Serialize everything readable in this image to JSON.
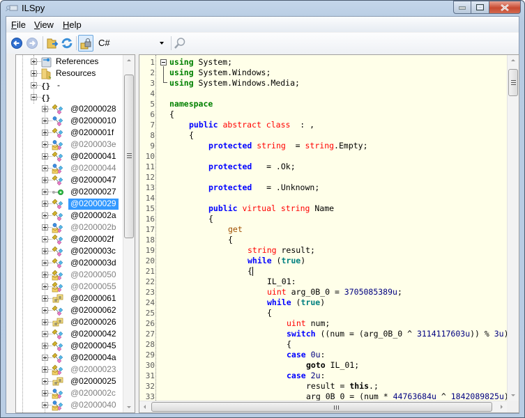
{
  "window": {
    "title": "ILSpy",
    "caption_buttons": [
      "minimize",
      "maximize",
      "close"
    ]
  },
  "menu": {
    "items": [
      {
        "label": "File",
        "accesskey": "F",
        "rest": "ile"
      },
      {
        "label": "View",
        "accesskey": "V",
        "rest": "iew"
      },
      {
        "label": "Help",
        "accesskey": "H",
        "rest": "elp"
      }
    ]
  },
  "toolbar": {
    "buttons": [
      {
        "name": "back",
        "icon": "back-arrow-icon"
      },
      {
        "name": "forward",
        "icon": "forward-arrow-icon"
      },
      {
        "name": "open",
        "icon": "open-folder-icon"
      },
      {
        "name": "reload",
        "icon": "refresh-icon"
      },
      {
        "name": "show-internal",
        "icon": "lock-icon",
        "pressed": true
      }
    ],
    "language": "C#",
    "search_icon": "search-icon"
  },
  "tree": {
    "nodes": [
      {
        "label": "References",
        "icon": "references-icon",
        "expander": "plus",
        "level": 1,
        "style": "normal"
      },
      {
        "label": "Resources",
        "icon": "folder-icon",
        "expander": "plus",
        "level": 1,
        "style": "normal"
      },
      {
        "label": "-",
        "icon": "namespace-icon",
        "expander": "plus",
        "level": 1,
        "style": "normal"
      },
      {
        "label": "",
        "icon": "namespace-icon",
        "expander": "minus",
        "level": 1,
        "style": "normal"
      },
      {
        "label": "@02000028",
        "icon": "class-icon",
        "expander": "plus",
        "level": 2,
        "style": "normal"
      },
      {
        "label": "@02000010",
        "icon": "class-blue-icon",
        "expander": "plus",
        "level": 2,
        "style": "normal"
      },
      {
        "label": "@0200001f",
        "icon": "class-icon",
        "expander": "plus",
        "level": 2,
        "style": "normal"
      },
      {
        "label": "@0200003e",
        "icon": "internal-class-icon",
        "expander": "plus",
        "level": 2,
        "style": "gray"
      },
      {
        "label": "@02000041",
        "icon": "class-icon",
        "expander": "plus",
        "level": 2,
        "style": "normal"
      },
      {
        "label": "@02000044",
        "icon": "internal-class-icon",
        "expander": "plus",
        "level": 2,
        "style": "gray"
      },
      {
        "label": "@02000047",
        "icon": "class-icon",
        "expander": "plus",
        "level": 2,
        "style": "normal"
      },
      {
        "label": "@02000027",
        "icon": "interface-icon",
        "expander": "plus",
        "level": 2,
        "style": "normal"
      },
      {
        "label": "@02000029",
        "icon": "class-icon",
        "expander": "plus",
        "level": 2,
        "style": "selected"
      },
      {
        "label": "@0200002a",
        "icon": "class-icon",
        "expander": "plus",
        "level": 2,
        "style": "normal"
      },
      {
        "label": "@0200002b",
        "icon": "internal-class-icon",
        "expander": "plus",
        "level": 2,
        "style": "gray"
      },
      {
        "label": "@0200002f",
        "icon": "class-icon",
        "expander": "plus",
        "level": 2,
        "style": "normal"
      },
      {
        "label": "@0200003c",
        "icon": "class-icon",
        "expander": "plus",
        "level": 2,
        "style": "normal"
      },
      {
        "label": "@0200003d",
        "icon": "class-icon",
        "expander": "plus",
        "level": 2,
        "style": "normal"
      },
      {
        "label": "@02000050",
        "icon": "internal-class-yellow-icon",
        "expander": "plus",
        "level": 2,
        "style": "gray"
      },
      {
        "label": "@02000055",
        "icon": "internal-class-yellow-icon",
        "expander": "plus",
        "level": 2,
        "style": "gray"
      },
      {
        "label": "@02000061",
        "icon": "enum-icon",
        "expander": "plus",
        "level": 2,
        "style": "normal"
      },
      {
        "label": "@02000062",
        "icon": "class-icon",
        "expander": "plus",
        "level": 2,
        "style": "normal"
      },
      {
        "label": "@02000026",
        "icon": "enum-icon",
        "expander": "plus",
        "level": 2,
        "style": "normal"
      },
      {
        "label": "@02000042",
        "icon": "class-icon",
        "expander": "plus",
        "level": 2,
        "style": "normal"
      },
      {
        "label": "@02000045",
        "icon": "class-icon",
        "expander": "plus",
        "level": 2,
        "style": "normal"
      },
      {
        "label": "@0200004a",
        "icon": "class-icon",
        "expander": "plus",
        "level": 2,
        "style": "normal"
      },
      {
        "label": "@02000023",
        "icon": "internal-class-yellow-icon",
        "expander": "plus",
        "level": 2,
        "style": "gray"
      },
      {
        "label": "@02000025",
        "icon": "enum-icon",
        "expander": "plus",
        "level": 2,
        "style": "normal"
      },
      {
        "label": "@0200002c",
        "icon": "internal-class-icon",
        "expander": "plus",
        "level": 2,
        "style": "gray"
      },
      {
        "label": "@02000040",
        "icon": "internal-class-icon",
        "expander": "plus",
        "level": 2,
        "style": "gray"
      }
    ]
  },
  "editor": {
    "lines": [
      {
        "n": "1",
        "indent": 0,
        "tokens": [
          [
            "using",
            "kw-green"
          ],
          [
            " System;",
            ""
          ]
        ]
      },
      {
        "n": "2",
        "indent": 0,
        "tokens": [
          [
            "using",
            "kw-green"
          ],
          [
            " System.Windows;",
            ""
          ]
        ]
      },
      {
        "n": "3",
        "indent": 0,
        "tokens": [
          [
            "using",
            "kw-green"
          ],
          [
            " System.Windows.Media;",
            ""
          ]
        ]
      },
      {
        "n": "4",
        "indent": 0,
        "tokens": []
      },
      {
        "n": "5",
        "indent": 0,
        "tokens": [
          [
            "namespace",
            "kw-green"
          ]
        ]
      },
      {
        "n": "6",
        "indent": 0,
        "tokens": [
          [
            "{",
            ""
          ]
        ]
      },
      {
        "n": "7",
        "indent": 1,
        "tokens": [
          [
            "public",
            "kw-blue"
          ],
          [
            " ",
            ""
          ],
          [
            "abstract class",
            "kw-red"
          ],
          [
            "  : ,",
            ""
          ]
        ]
      },
      {
        "n": "8",
        "indent": 1,
        "tokens": [
          [
            "{",
            ""
          ]
        ]
      },
      {
        "n": "9",
        "indent": 2,
        "tokens": [
          [
            "protected",
            "kw-blue"
          ],
          [
            " ",
            ""
          ],
          [
            "string",
            "kw-red"
          ],
          [
            "  = ",
            ""
          ],
          [
            "string",
            "kw-red"
          ],
          [
            ".Empty;",
            ""
          ]
        ]
      },
      {
        "n": "10",
        "indent": 0,
        "tokens": []
      },
      {
        "n": "11",
        "indent": 2,
        "tokens": [
          [
            "protected",
            "kw-blue"
          ],
          [
            "   = .Ok;",
            ""
          ]
        ]
      },
      {
        "n": "12",
        "indent": 0,
        "tokens": []
      },
      {
        "n": "13",
        "indent": 2,
        "tokens": [
          [
            "protected",
            "kw-blue"
          ],
          [
            "   = .Unknown;",
            ""
          ]
        ]
      },
      {
        "n": "14",
        "indent": 0,
        "tokens": []
      },
      {
        "n": "15",
        "indent": 2,
        "tokens": [
          [
            "public",
            "kw-blue"
          ],
          [
            " ",
            ""
          ],
          [
            "virtual string",
            "kw-red"
          ],
          [
            " Name",
            ""
          ]
        ]
      },
      {
        "n": "16",
        "indent": 2,
        "tokens": [
          [
            "{",
            ""
          ]
        ]
      },
      {
        "n": "17",
        "indent": 3,
        "tokens": [
          [
            "get",
            "kw-brown"
          ]
        ]
      },
      {
        "n": "18",
        "indent": 3,
        "tokens": [
          [
            "{",
            ""
          ]
        ]
      },
      {
        "n": "19",
        "indent": 4,
        "tokens": [
          [
            "string",
            "kw-red"
          ],
          [
            " result;",
            ""
          ]
        ]
      },
      {
        "n": "20",
        "indent": 4,
        "tokens": [
          [
            "while",
            "kw-blue"
          ],
          [
            " (",
            ""
          ],
          [
            "true",
            "kw-teal"
          ],
          [
            ")",
            ""
          ]
        ]
      },
      {
        "n": "21",
        "indent": 4,
        "tokens": [
          [
            "{",
            ""
          ]
        ],
        "cursor": true
      },
      {
        "n": "22",
        "indent": 5,
        "tokens": [
          [
            "IL_01:",
            ""
          ]
        ]
      },
      {
        "n": "23",
        "indent": 5,
        "tokens": [
          [
            "uint",
            "kw-red"
          ],
          [
            " arg_0B_0 = ",
            ""
          ],
          [
            "3705085389u",
            "num"
          ],
          [
            ";",
            ""
          ]
        ]
      },
      {
        "n": "24",
        "indent": 5,
        "tokens": [
          [
            "while",
            "kw-blue"
          ],
          [
            " (",
            ""
          ],
          [
            "true",
            "kw-teal"
          ],
          [
            ")",
            ""
          ]
        ]
      },
      {
        "n": "25",
        "indent": 5,
        "tokens": [
          [
            "{",
            ""
          ]
        ]
      },
      {
        "n": "26",
        "indent": 6,
        "tokens": [
          [
            "uint",
            "kw-red"
          ],
          [
            " num;",
            ""
          ]
        ]
      },
      {
        "n": "27",
        "indent": 6,
        "tokens": [
          [
            "switch",
            "kw-blue"
          ],
          [
            " ((num = (arg_0B_0 ^ ",
            ""
          ],
          [
            "3114117603u",
            "num"
          ],
          [
            ")) % ",
            ""
          ],
          [
            "3u",
            "num"
          ],
          [
            ")",
            ""
          ]
        ]
      },
      {
        "n": "28",
        "indent": 6,
        "tokens": [
          [
            "{",
            ""
          ]
        ]
      },
      {
        "n": "29",
        "indent": 6,
        "tokens": [
          [
            "case",
            "kw-blue"
          ],
          [
            " ",
            ""
          ],
          [
            "0u",
            "num"
          ],
          [
            ":",
            ""
          ]
        ]
      },
      {
        "n": "30",
        "indent": 7,
        "tokens": [
          [
            "goto",
            "kw-black"
          ],
          [
            " IL_01;",
            ""
          ]
        ]
      },
      {
        "n": "31",
        "indent": 6,
        "tokens": [
          [
            "case",
            "kw-blue"
          ],
          [
            " ",
            ""
          ],
          [
            "2u",
            "num"
          ],
          [
            ":",
            ""
          ]
        ]
      },
      {
        "n": "32",
        "indent": 7,
        "tokens": [
          [
            "result = ",
            ""
          ],
          [
            "this",
            "kw-black"
          ],
          [
            ".;",
            ""
          ]
        ]
      },
      {
        "n": "33",
        "indent": 7,
        "tokens": [
          [
            "arg_0B_0 = (num * ",
            ""
          ],
          [
            "44763684u",
            "num"
          ],
          [
            " ^ ",
            ""
          ],
          [
            "1842089825u",
            "num"
          ],
          [
            ");",
            ""
          ]
        ]
      }
    ]
  }
}
